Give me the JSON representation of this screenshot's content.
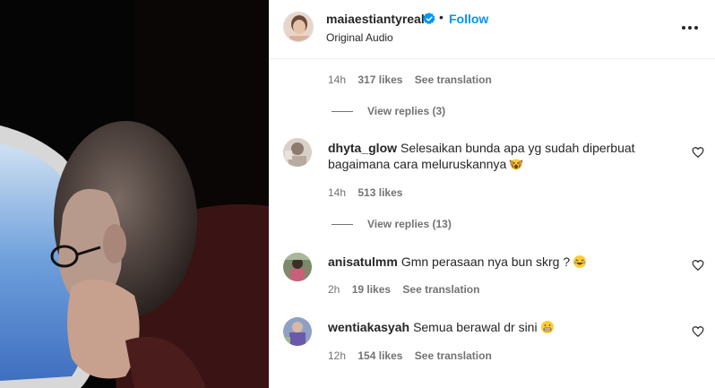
{
  "post": {
    "username": "maiaestiantyreal",
    "separator": "•",
    "follow_label": "Follow",
    "audio_label": "Original Audio"
  },
  "thread_top": {
    "time": "14h",
    "likes": "317 likes",
    "translation": "See translation",
    "replies_label": "View replies (3)"
  },
  "comments": [
    {
      "username": "dhyta_glow",
      "text_line1": "Selesaikan bunda apa yg sudah diperbuat",
      "text_line2": "bagaimana cara meluruskannya",
      "emoji": "raised-hands-face-emoji",
      "time": "14h",
      "likes": "513 likes",
      "replies_label": "View replies (13)"
    },
    {
      "username": "anisatulmm",
      "text": "Gmn perasaan nya bun skrg ?",
      "emoji": "laughing-emoji",
      "time": "2h",
      "likes": "19 likes",
      "translation": "See translation"
    },
    {
      "username": "wentiakasyah",
      "text": "Semua berawal dr sini",
      "emoji": "grimace-emoji",
      "time": "12h",
      "likes": "154 likes",
      "translation": "See translation"
    }
  ],
  "colors": {
    "accent": "#0095f6",
    "text": "#262626",
    "muted": "#737373",
    "verified": "#0095f6"
  },
  "icons": [
    "verified-badge-icon",
    "more-options-icon",
    "heart-icon"
  ]
}
